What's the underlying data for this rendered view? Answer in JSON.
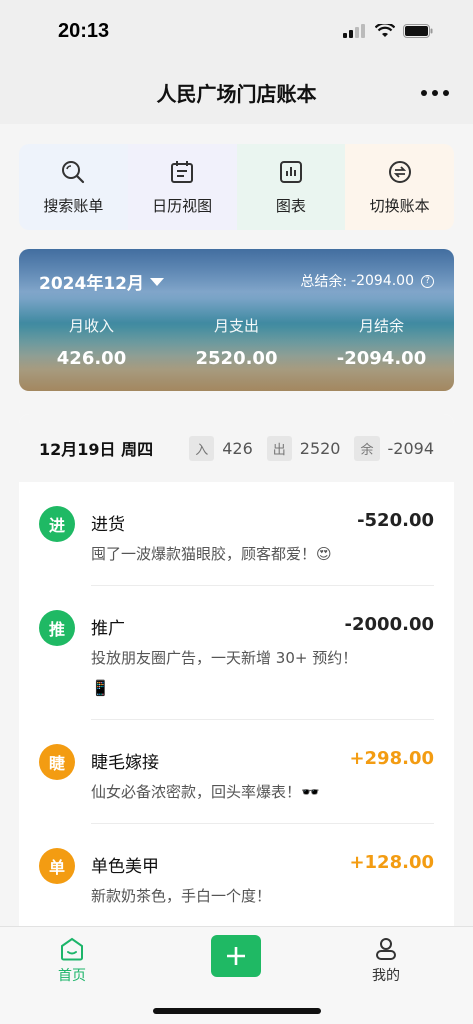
{
  "status": {
    "time": "20:13"
  },
  "nav": {
    "title": "人民广场门店账本"
  },
  "quick_actions": [
    {
      "label": "搜索账单",
      "icon": "search-icon"
    },
    {
      "label": "日历视图",
      "icon": "calendar-icon"
    },
    {
      "label": "图表",
      "icon": "chart-icon"
    },
    {
      "label": "切换账本",
      "icon": "switch-icon"
    }
  ],
  "summary": {
    "month": "2024年12月",
    "total_label": "总结余:",
    "total_value": "-2094.00",
    "income_label": "月收入",
    "income_value": "426.00",
    "expense_label": "月支出",
    "expense_value": "2520.00",
    "balance_label": "月结余",
    "balance_value": "-2094.00"
  },
  "day": {
    "date": "12月19日 周四",
    "in_tag": "入",
    "in_value": "426",
    "out_tag": "出",
    "out_value": "2520",
    "bal_tag": "余",
    "bal_value": "-2094"
  },
  "transactions": [
    {
      "avatar": "进",
      "title": "进货",
      "amount": "-520.00",
      "note": "囤了一波爆款猫眼胶，顾客都爱！😍",
      "color": "#1fb964",
      "amount_color": "#222222"
    },
    {
      "avatar": "推",
      "title": "推广",
      "amount": "-2000.00",
      "note": "投放朋友圈广告，一天新增 30+ 预约！📱",
      "color": "#1fb964",
      "amount_color": "#222222"
    },
    {
      "avatar": "睫",
      "title": "睫毛嫁接",
      "amount": "+298.00",
      "note": "仙女必备浓密款，回头率爆表！🕶️",
      "color": "#f39c12",
      "amount_color": "#f39c12"
    },
    {
      "avatar": "单",
      "title": "单色美甲",
      "amount": "+128.00",
      "note": "新款奶茶色，手白一个度！",
      "color": "#f39c12",
      "amount_color": "#f39c12"
    }
  ],
  "tabs": {
    "home": "首页",
    "mine": "我的"
  }
}
